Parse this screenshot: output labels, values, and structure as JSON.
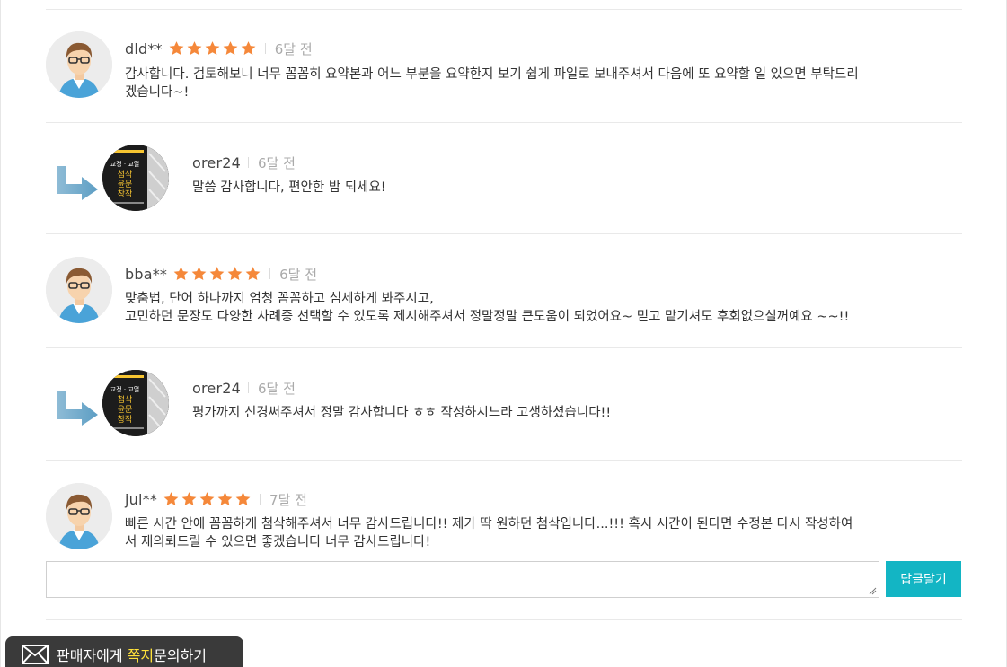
{
  "reviews": [
    {
      "author": "dld**",
      "rating": 5,
      "time": "6달 전",
      "lines": [
        "감사합니다. 검토해보니 너무 꼼꼼히 요약본과 어느 부분을 요약한지 보기 쉽게 파일로 보내주셔서 다음에 또 요약할 일 있으면 부탁드리",
        "겠습니다~!"
      ]
    },
    {
      "author": "bba**",
      "rating": 5,
      "time": "6달 전",
      "lines": [
        "맞춤법, 단어 하나까지 엄청 꼼꼼하고 섬세하게 봐주시고,",
        "고민하던 문장도 다양한 사례중 선택할 수 있도록 제시해주셔서 정말정말 큰도움이 되었어요~ 믿고 맡기셔도 후회없으실꺼예요 ~~!!"
      ]
    },
    {
      "author": "jul**",
      "rating": 5,
      "time": "7달 전",
      "lines": [
        "빠른 시간 안에 꼼꼼하게 첨삭해주셔서 너무 감사드립니다!! 제가 딱 원하던 첨삭입니다...!!! 혹시 시간이 된다면 수정본 다시 작성하여",
        "서 재의뢰드릴 수 있으면 좋겠습니다 너무 감사드립니다!"
      ]
    }
  ],
  "replies": [
    {
      "author": "orer24",
      "time": "6달 전",
      "text": "말씀 감사합니다, 편안한 밤 되세요!"
    },
    {
      "author": "orer24",
      "time": "6달 전",
      "text": "평가까지 신경써주셔서 정말 감사합니다 ㅎㅎ 작성하시느라 고생하셨습니다!!"
    }
  ],
  "seller_avatar_text": [
    "교정 · 교열",
    "첨삭",
    "윤문",
    "창작"
  ],
  "reply_input": {
    "value": "",
    "placeholder": ""
  },
  "reply_button_label": "답글달기",
  "message_button": {
    "label_before": "판매자에게 ",
    "label_highlight": "쪽지",
    "label_after": "문의하기"
  },
  "colors": {
    "star": "#f5883a",
    "accent": "#13b5c4",
    "highlight": "#ffe23a",
    "dark_button": "#3a3a3a"
  },
  "icons": {
    "star": "star-icon",
    "reply": "reply-arrow-icon",
    "mail": "mail-icon"
  }
}
